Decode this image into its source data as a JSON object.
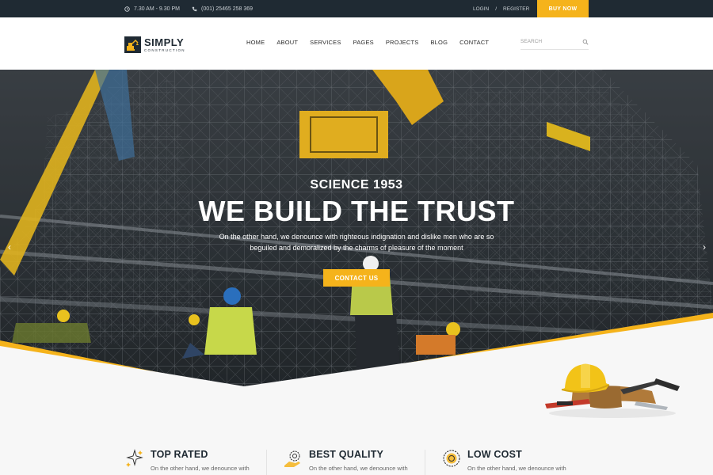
{
  "topbar": {
    "hours": "7.30 AM - 9.30 PM",
    "phone": "(001) 25465 258 369",
    "login": "LOGIN",
    "separator": "/",
    "register": "REGISTER",
    "buy_now": "BUY NOW"
  },
  "logo": {
    "title": "SIMPLY",
    "subtitle": "CONSTRUCTION"
  },
  "nav": {
    "items": [
      "HOME",
      "ABOUT",
      "SERVICES",
      "PAGES",
      "PROJECTS",
      "BLOG",
      "CONTACT"
    ]
  },
  "search": {
    "placeholder": "SEARCH"
  },
  "hero": {
    "eyebrow": "SCIENCE 1953",
    "headline": "WE BUILD THE TRUST",
    "subtext_line1": "On the other hand, we denounce with righteous indignation and dislike men who are so",
    "subtext_line2": "beguiled and demoralized by the charms of pleasure of the moment",
    "cta": "CONTACT US",
    "prev_arrow": "‹",
    "next_arrow": "›"
  },
  "features": [
    {
      "title": "TOP RATED",
      "text": "On the other hand, we denounce with",
      "icon": "stars-icon"
    },
    {
      "title": "BEST QUALITY",
      "text": "On the other hand, we denounce with",
      "icon": "gear-hand-icon"
    },
    {
      "title": "LOW COST",
      "text": "On the other hand, we denounce with",
      "icon": "coin-gear-icon"
    }
  ],
  "colors": {
    "accent": "#f5b31b",
    "dark": "#1f2a33",
    "light_bg": "#f7f7f7"
  }
}
